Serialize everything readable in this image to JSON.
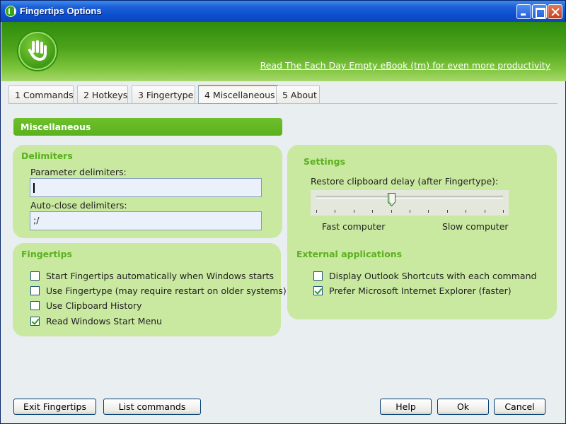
{
  "window": {
    "title": "Fingertips Options"
  },
  "banner": {
    "promo_link": "Read The Each Day Empty eBook (tm) for even more productivity"
  },
  "tabs": [
    {
      "label": "1 Commands",
      "active": false
    },
    {
      "label": "2 Hotkeys",
      "active": false
    },
    {
      "label": "3 Fingertype",
      "active": false
    },
    {
      "label": "4 Miscellaneous",
      "active": true
    },
    {
      "label": "5 About",
      "active": false
    }
  ],
  "section": {
    "title": "Miscellaneous"
  },
  "delimiters": {
    "title": "Delimiters",
    "parameter_label": "Parameter delimiters:",
    "parameter_value": "",
    "autoclose_label": "Auto-close delimiters:",
    "autoclose_value": ";/"
  },
  "fingertips": {
    "title": "Fingertips",
    "options": [
      {
        "label": "Start Fingertips automatically when Windows starts",
        "checked": false
      },
      {
        "label": "Use Fingertype (may require restart on older systems)",
        "checked": false
      },
      {
        "label": "Use Clipboard History",
        "checked": false
      },
      {
        "label": "Read Windows Start Menu",
        "checked": true
      }
    ]
  },
  "settings": {
    "title": "Settings",
    "restore_label": "Restore clipboard delay (after Fingertype):",
    "slider_level": 0.4,
    "fast_label": "Fast computer",
    "slow_label": "Slow computer"
  },
  "external": {
    "title": "External applications",
    "options": [
      {
        "label": "Display Outlook Shortcuts with each command",
        "checked": false
      },
      {
        "label": "Prefer Microsoft Internet Explorer (faster)",
        "checked": true
      }
    ]
  },
  "buttons": {
    "exit": "Exit Fingertips",
    "list": "List commands",
    "help": "Help",
    "ok": "Ok",
    "cancel": "Cancel"
  },
  "colors": {
    "accent_green": "#5ab11e",
    "panel_green": "#c9e8a0",
    "titlebar_blue": "#0a4ed0"
  }
}
